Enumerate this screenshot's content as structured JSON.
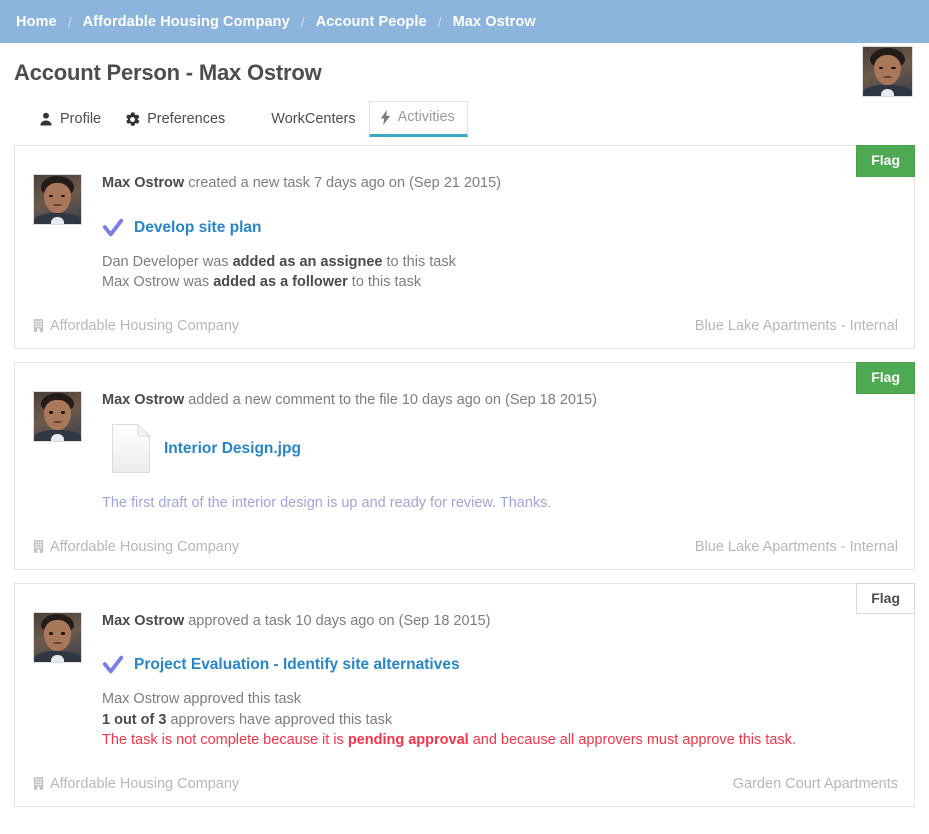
{
  "breadcrumb": {
    "separator": "/",
    "items": [
      {
        "label": "Home"
      },
      {
        "label": "Affordable Housing Company"
      },
      {
        "label": "Account People"
      },
      {
        "label": "Max Ostrow"
      }
    ]
  },
  "header": {
    "title": "Account Person - Max Ostrow",
    "avatar_name": "user-avatar"
  },
  "tabs": [
    {
      "label": "Profile",
      "icon": "user-icon",
      "active": false
    },
    {
      "label": "Preferences",
      "icon": "gear-icon",
      "active": false
    },
    {
      "label": "WorkCenters",
      "icon": "grid-icon",
      "active": false
    },
    {
      "label": "Activities",
      "icon": "lightning-icon",
      "active": true
    }
  ],
  "colors": {
    "breadcrumb_bg": "#8cb4dc",
    "flag_green": "#4eaa52",
    "link_blue": "#2886c8",
    "check_purple": "#7b7fe0",
    "danger_red": "#f5344a",
    "comment_lavender": "#a3a4dd",
    "active_tab_underline": "#3ba7c4"
  },
  "activities": [
    {
      "flag_label": "Flag",
      "flag_style": "green",
      "actor": "Max Ostrow",
      "action": " created a new task 7 days ago on (Sep 21 2015)",
      "subject_type": "task",
      "subject_icon": "check-icon",
      "subject": "Develop site plan",
      "details": [
        {
          "pre": "Dan Developer was ",
          "strong": "added as an assignee",
          "post": " to this task",
          "danger": false
        },
        {
          "pre": "Max Ostrow was ",
          "strong": "added as a follower",
          "post": " to this task",
          "danger": false
        }
      ],
      "comment": "",
      "footer_left": "Affordable Housing Company",
      "footer_left_icon": "building-icon",
      "footer_right": "Blue Lake Apartments - Internal",
      "footer_right_icon": "grid-icon"
    },
    {
      "flag_label": "Flag",
      "flag_style": "green",
      "actor": "Max Ostrow",
      "action": " added a new comment to the file 10 days ago on (Sep 18 2015)",
      "subject_type": "file",
      "subject_icon": "file-icon",
      "subject": "Interior Design.jpg",
      "details": [],
      "comment": "The first draft of the interior design is up and ready for review. Thanks.",
      "footer_left": "Affordable Housing Company",
      "footer_left_icon": "building-icon",
      "footer_right": "Blue Lake Apartments - Internal",
      "footer_right_icon": "grid-icon"
    },
    {
      "flag_label": "Flag",
      "flag_style": "plain",
      "actor": "Max Ostrow",
      "action": " approved a task 10 days ago on (Sep 18 2015)",
      "subject_type": "task",
      "subject_icon": "check-icon",
      "subject": "Project Evaluation - Identify site alternatives",
      "details": [
        {
          "pre": "Max Ostrow approved this task",
          "strong": "",
          "post": "",
          "danger": false
        },
        {
          "pre": "",
          "strong": "1 out of 3",
          "post": " approvers have approved this task",
          "danger": false
        },
        {
          "pre": "The task is not complete because it is ",
          "strong": "pending approval",
          "post": " and because all approvers must approve this task.",
          "danger": true
        }
      ],
      "comment": "",
      "footer_left": "Affordable Housing Company",
      "footer_left_icon": "building-icon",
      "footer_right": "Garden Court Apartments",
      "footer_right_icon": "grid-icon"
    }
  ]
}
